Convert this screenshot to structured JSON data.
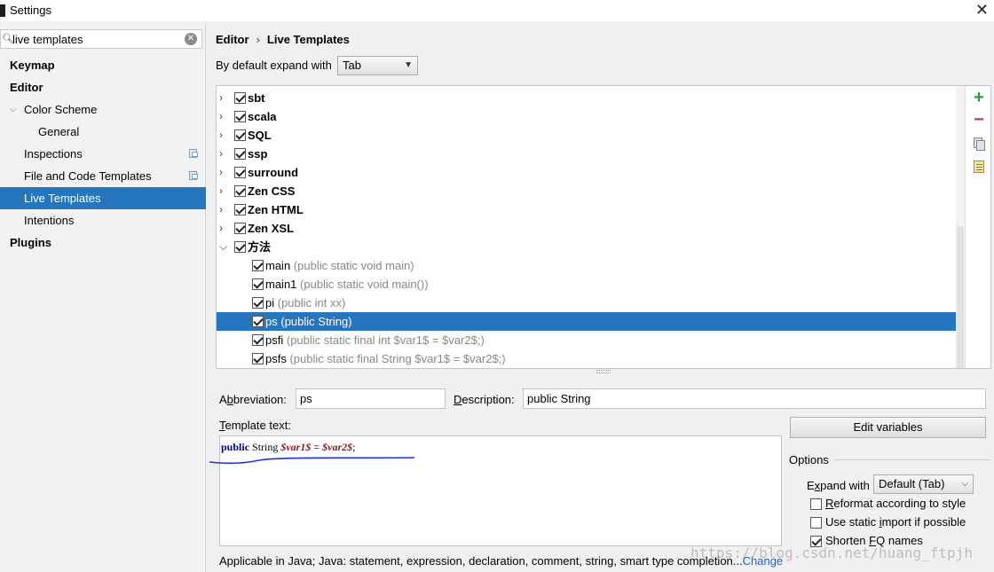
{
  "window": {
    "title": "Settings"
  },
  "sidebar": {
    "search_value": "live templates",
    "items": [
      {
        "label": "Keymap"
      },
      {
        "label": "Editor"
      },
      {
        "label": "Color Scheme"
      },
      {
        "label": "General"
      },
      {
        "label": "Inspections"
      },
      {
        "label": "File and Code Templates"
      },
      {
        "label": "Live Templates"
      },
      {
        "label": "Intentions"
      },
      {
        "label": "Plugins"
      }
    ]
  },
  "breadcrumb": {
    "parent": "Editor",
    "current": "Live Templates"
  },
  "expand": {
    "label": "By default expand with",
    "value": "Tab"
  },
  "templates": {
    "groups": [
      "sbt",
      "scala",
      "SQL",
      "ssp",
      "surround",
      "Zen CSS",
      "Zen HTML",
      "Zen XSL",
      "方法"
    ],
    "items": [
      {
        "name": "main",
        "desc": "(public static void main)"
      },
      {
        "name": "main1",
        "desc": "(public static void main())"
      },
      {
        "name": "pi",
        "desc": "(public int xx)"
      },
      {
        "name": "ps",
        "desc": "(public String)"
      },
      {
        "name": "psfi",
        "desc": "(public static final int $var1$ = $var2$;)"
      },
      {
        "name": "psfs",
        "desc": "(public static final String $var1$ = $var2$;)"
      }
    ],
    "selected": "ps"
  },
  "form": {
    "abbreviation_label_pre": "A",
    "abbreviation_label_u": "b",
    "abbreviation_label_post": "breviation:",
    "abbreviation_value": "ps",
    "description_label_u": "D",
    "description_label_post": "escription:",
    "description_value": "public String",
    "template_text_label_u": "T",
    "template_text_label_post": "emplate text:",
    "template_kw": "public",
    "template_type": "String",
    "template_var1": "$var1$",
    "template_eq": "=",
    "template_var2": "$var2$",
    "template_semi": ";",
    "edit_variables": "Edit variables"
  },
  "options": {
    "title": "Options",
    "expand_label_pre": "E",
    "expand_label_u": "x",
    "expand_label_post": "pand with",
    "expand_value": "Default (Tab)",
    "checkboxes": [
      {
        "u": "R",
        "rest": "eformat according to style",
        "checked": false
      },
      {
        "pre": "Use static ",
        "u": "i",
        "rest": "mport if possible",
        "checked": false
      },
      {
        "pre": "Shorten ",
        "u": "F",
        "rest": "Q names",
        "checked": true
      }
    ]
  },
  "footer": {
    "applicable": "Applicable in Java; Java: statement, expression, declaration, comment, string, smart type completion...",
    "change_link": "Change"
  },
  "watermark": "https://blog.csdn.net/huang_ftpjh"
}
